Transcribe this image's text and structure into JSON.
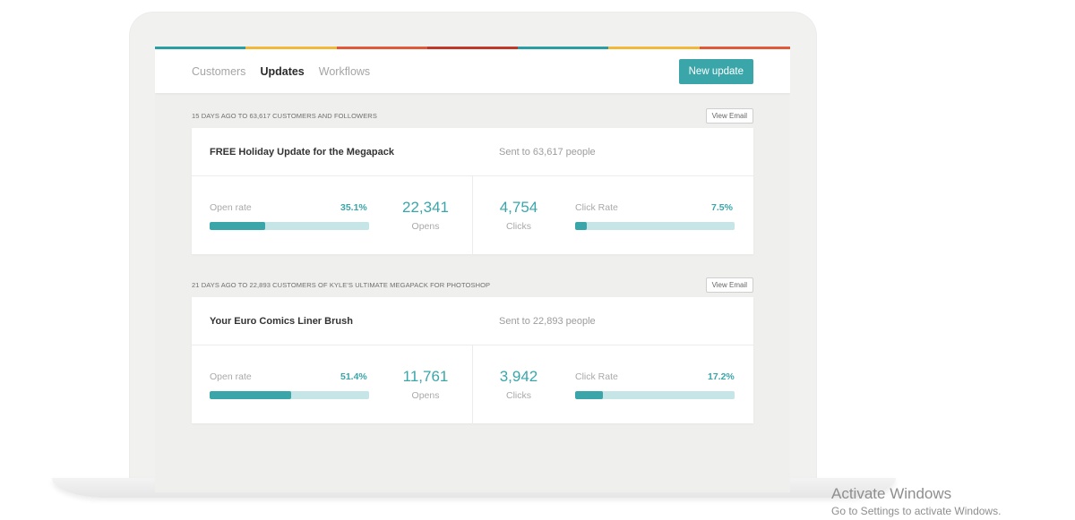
{
  "nav": {
    "tabs": [
      "Customers",
      "Updates",
      "Workflows"
    ],
    "active_tab": "Updates",
    "new_update_label": "New update"
  },
  "stripe_colors": [
    "#2a9ea4",
    "#f0b93a",
    "#e05a3a",
    "#c0392b",
    "#2a9ea4",
    "#f0b93a",
    "#e05a3a"
  ],
  "accent_color": "#3aa6aa",
  "updates": [
    {
      "meta": "15 DAYS AGO TO 63,617 CUSTOMERS AND FOLLOWERS",
      "view_label": "View Email",
      "title": "FREE Holiday Update for the Megapack",
      "sent": "Sent to 63,617 people",
      "open_label": "Open rate",
      "open_rate": "35.1%",
      "open_fraction": 0.351,
      "opens": "22,341",
      "opens_label": "Opens",
      "clicks": "4,754",
      "clicks_label": "Clicks",
      "click_label": "Click Rate",
      "click_rate": "7.5%",
      "click_fraction": 0.075
    },
    {
      "meta": "21 DAYS AGO TO 22,893 CUSTOMERS OF KYLE'S ULTIMATE MEGAPACK FOR PHOTOSHOP",
      "view_label": "View Email",
      "title": "Your Euro Comics Liner Brush",
      "sent": "Sent to 22,893 people",
      "open_label": "Open rate",
      "open_rate": "51.4%",
      "open_fraction": 0.514,
      "opens": "11,761",
      "opens_label": "Opens",
      "clicks": "3,942",
      "clicks_label": "Clicks",
      "click_label": "Click Rate",
      "click_rate": "17.2%",
      "click_fraction": 0.172
    }
  ],
  "watermark": {
    "line1": "Activate Windows",
    "line2": "Go to Settings to activate Windows."
  }
}
